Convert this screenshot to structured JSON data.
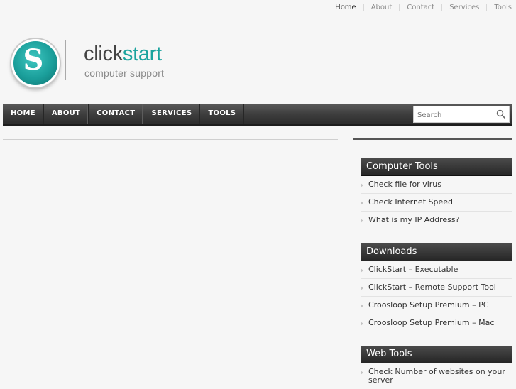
{
  "top_nav": [
    "Home",
    "About",
    "Contact",
    "Services",
    "Tools"
  ],
  "logo": {
    "letter": "S",
    "title_prefix": "click",
    "title_accent": "start",
    "tagline": "computer support"
  },
  "main_nav": [
    "HOME",
    "ABOUT",
    "CONTACT",
    "SERVICES",
    "TOOLS"
  ],
  "search": {
    "placeholder": "Search"
  },
  "sidebar": {
    "computer_tools": {
      "title": "Computer Tools",
      "items": [
        "Check file for virus",
        "Check Internet Speed",
        "What is my IP Address?"
      ]
    },
    "downloads": {
      "title": "Downloads",
      "items": [
        "ClickStart – Executable",
        "ClickStart – Remote Support Tool",
        "Croosloop Setup Premium – PC",
        "Croosloop Setup Premium – Mac"
      ]
    },
    "web_tools": {
      "title": "Web Tools",
      "items": [
        "Check Number of websites on your server"
      ]
    }
  },
  "colors": {
    "accent": "#1aa39e",
    "nav_bg": "#3e3e3e"
  }
}
